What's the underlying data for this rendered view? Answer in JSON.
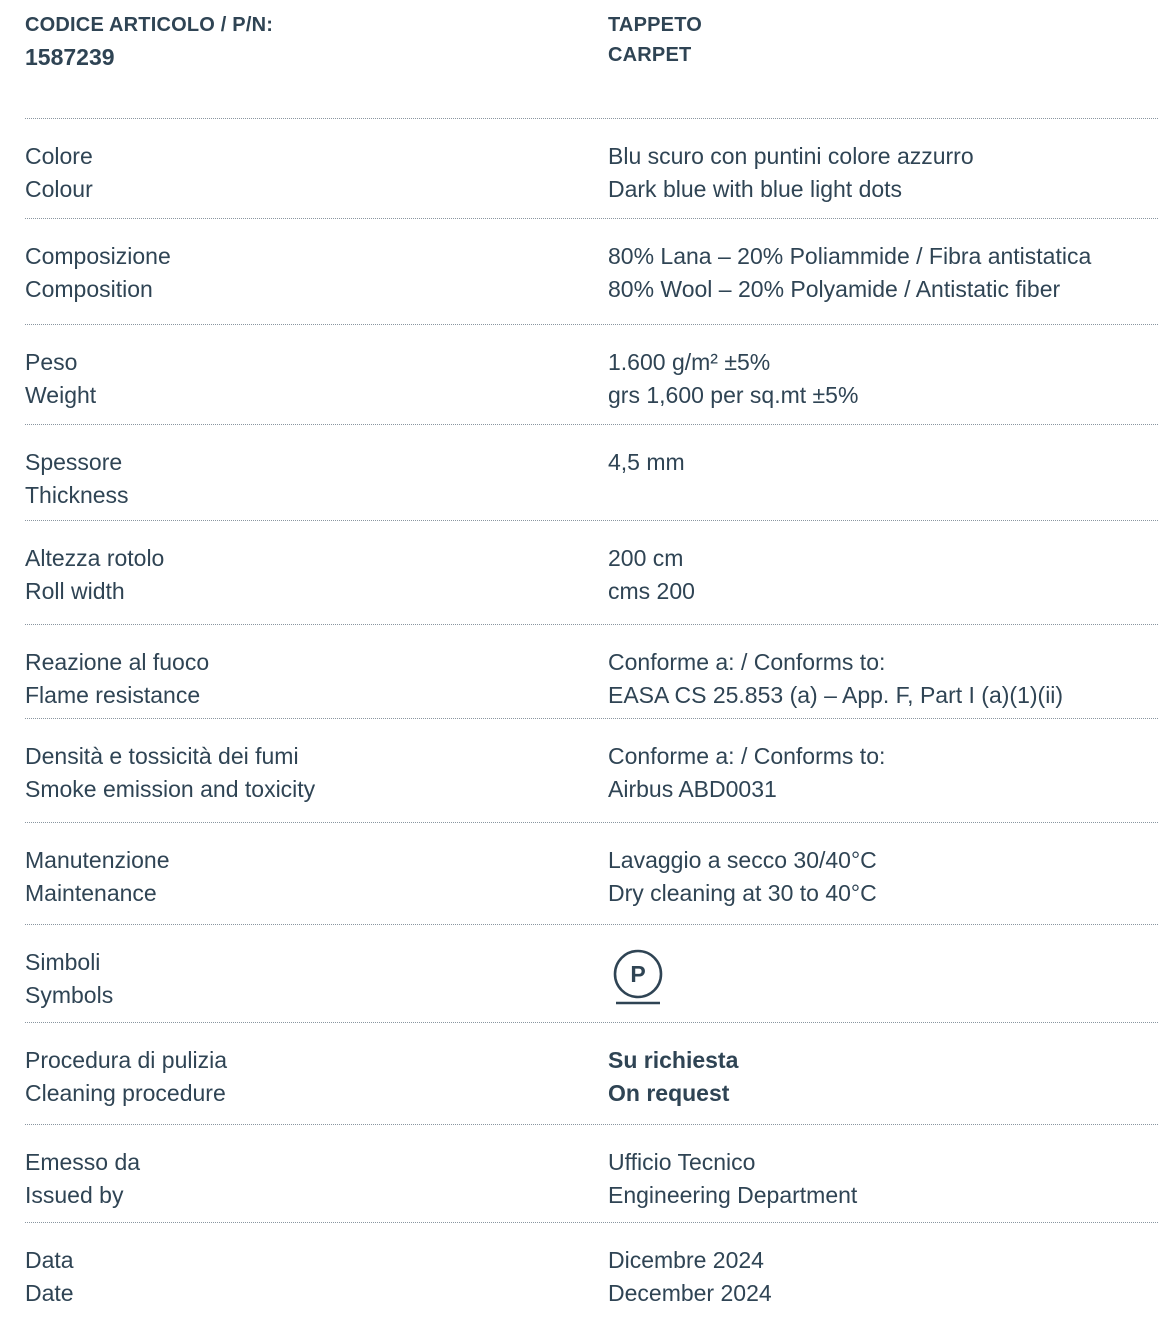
{
  "header": {
    "code_label": "CODICE ARTICOLO / P/N:",
    "code_value": "1587239",
    "product_it": "TAPPETO",
    "product_en": "CARPET"
  },
  "rows": [
    {
      "label_it": "Colore",
      "label_en": "Colour",
      "value_it": "Blu scuro con puntini colore azzurro",
      "value_en": "Dark blue with blue light dots"
    },
    {
      "label_it": "Composizione",
      "label_en": "Composition",
      "value_it": "80% Lana – 20% Poliammide / Fibra antistatica",
      "value_en": "80% Wool – 20% Polyamide / Antistatic fiber"
    },
    {
      "label_it": "Peso",
      "label_en": "Weight",
      "value_it": "1.600 g/m² ±5%",
      "value_en": "grs 1,600 per sq.mt ±5%"
    },
    {
      "label_it": "Spessore",
      "label_en": "Thickness",
      "value_it": "4,5 mm",
      "value_en": ""
    },
    {
      "label_it": "Altezza rotolo",
      "label_en": "Roll width",
      "value_it": "200 cm",
      "value_en": "cms 200"
    },
    {
      "label_it": "Reazione al fuoco",
      "label_en": "Flame resistance",
      "value_it": "Conforme a: / Conforms to:",
      "value_en": "EASA CS 25.853 (a) – App. F, Part I (a)(1)(ii)"
    },
    {
      "label_it": "Densità e tossicità dei fumi",
      "label_en": "Smoke emission and toxicity",
      "value_it": "Conforme a: / Conforms to:",
      "value_en": "Airbus ABD0031"
    },
    {
      "label_it": "Manutenzione",
      "label_en": "Maintenance",
      "value_it": "Lavaggio a secco 30/40°C",
      "value_en": "Dry cleaning at 30 to 40°C"
    },
    {
      "label_it": "Simboli",
      "label_en": "Symbols",
      "symbol_letter": "P",
      "symbol_icon": "dry-clean-p-icon"
    },
    {
      "label_it": "Procedura di pulizia",
      "label_en": "Cleaning procedure",
      "value_it": "Su richiesta",
      "value_en": "On request"
    },
    {
      "label_it": "Emesso da",
      "label_en": "Issued by",
      "value_it": "Ufficio Tecnico",
      "value_en": "Engineering Department"
    },
    {
      "label_it": "Data",
      "label_en": "Date",
      "value_it": "Dicembre 2024",
      "value_en": "December 2024"
    }
  ],
  "colors": {
    "text": "#2f4454",
    "divider": "#8a96a0",
    "background": "#ffffff"
  }
}
